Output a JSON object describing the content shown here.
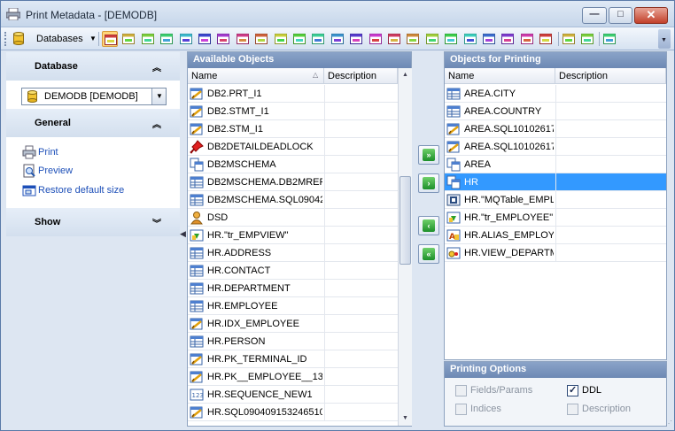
{
  "window": {
    "title": "Print Metadata - [DEMODB]",
    "controls": {
      "minimize": "—",
      "maximize": "□",
      "close": "✕"
    }
  },
  "toolbar": {
    "databases_label": "Databases",
    "buttons": [
      "tables-icon",
      "views-icon",
      "procedures-icon",
      "udf-icon",
      "triggers-icon",
      "indices-icon",
      "printer-icon",
      "sequences-icon",
      "aliases-icon",
      "mqt-icon",
      "users-icon",
      "udt-icon",
      "modules-icon",
      "schemas-icon",
      "packages-icon",
      "deadlock-monitor-icon",
      "tablespaces-icon",
      "bufferpools-icon",
      "groups-icon",
      "partitions-icon",
      "wrappers-icon",
      "servers-icon",
      "nicknames-icon",
      "roles-icon",
      "preview-icon",
      "print-icon",
      "restore-window-icon"
    ]
  },
  "sidebar": {
    "database": {
      "title": "Database",
      "selected": "DEMODB [DEMODB]"
    },
    "general": {
      "title": "General",
      "links": [
        {
          "label": "Print",
          "icon": "printer-icon"
        },
        {
          "label": "Preview",
          "icon": "preview-icon"
        },
        {
          "label": "Restore default size",
          "icon": "restore-size-icon"
        }
      ]
    },
    "show": {
      "title": "Show"
    }
  },
  "available": {
    "title": "Available Objects",
    "columns": [
      "Name",
      "Description"
    ],
    "rows": [
      {
        "name": "DB2.PRT_I1",
        "icon": "index-icon"
      },
      {
        "name": "DB2.STMT_I1",
        "icon": "index-icon"
      },
      {
        "name": "DB2.STM_I1",
        "icon": "index-icon"
      },
      {
        "name": "DB2DETAILDEADLOCK",
        "icon": "event-monitor-icon"
      },
      {
        "name": "DB2MSCHEMA",
        "icon": "schema-icon"
      },
      {
        "name": "DB2MSCHEMA.DB2MREF",
        "icon": "table-icon"
      },
      {
        "name": "DB2MSCHEMA.SQL09042",
        "icon": "table-icon"
      },
      {
        "name": "DSD",
        "icon": "user-icon"
      },
      {
        "name": "HR.\"tr_EMPVIEW\"",
        "icon": "trigger-icon"
      },
      {
        "name": "HR.ADDRESS",
        "icon": "table-icon"
      },
      {
        "name": "HR.CONTACT",
        "icon": "table-icon"
      },
      {
        "name": "HR.DEPARTMENT",
        "icon": "table-icon"
      },
      {
        "name": "HR.EMPLOYEE",
        "icon": "table-icon"
      },
      {
        "name": "HR.IDX_EMPLOYEE",
        "icon": "index-icon"
      },
      {
        "name": "HR.PERSON",
        "icon": "table-icon"
      },
      {
        "name": "HR.PK_TERMINAL_ID",
        "icon": "index-icon"
      },
      {
        "name": "HR.PK__EMPLOYEE__134",
        "icon": "index-icon"
      },
      {
        "name": "HR.SEQUENCE_NEW1",
        "icon": "sequence-icon"
      },
      {
        "name": "HR.SQL0904091532465100",
        "icon": "index-icon"
      }
    ]
  },
  "printing": {
    "title": "Objects for Printing",
    "columns": [
      "Name",
      "Description"
    ],
    "rows": [
      {
        "name": "AREA.CITY",
        "icon": "table-icon"
      },
      {
        "name": "AREA.COUNTRY",
        "icon": "table-icon"
      },
      {
        "name": "AREA.SQL10102617",
        "icon": "index-icon"
      },
      {
        "name": "AREA.SQL10102617",
        "icon": "index-icon"
      },
      {
        "name": "AREA",
        "icon": "schema-icon"
      },
      {
        "name": "HR",
        "icon": "schema-icon",
        "selected": true
      },
      {
        "name": "HR.\"MQTable_EMPL",
        "icon": "mqt-icon"
      },
      {
        "name": "HR.\"tr_EMPLOYEE\"",
        "icon": "trigger-icon"
      },
      {
        "name": "HR.ALIAS_EMPLOY",
        "icon": "alias-icon"
      },
      {
        "name": "HR.VIEW_DEPARTM",
        "icon": "view-icon"
      }
    ]
  },
  "move_buttons": [
    {
      "glyph": "»",
      "name": "add-all-button"
    },
    {
      "glyph": "›",
      "name": "add-selected-button"
    },
    {
      "glyph": "‹",
      "name": "remove-selected-button"
    },
    {
      "glyph": "«",
      "name": "remove-all-button"
    }
  ],
  "options": {
    "title": "Printing Options",
    "fields_params": "Fields/Params",
    "ddl": "DDL",
    "indices": "Indices",
    "description": "Description"
  },
  "colors": {
    "selection": "#3399ff",
    "panel_title": "#7a95be",
    "link": "#1d4fb8"
  }
}
